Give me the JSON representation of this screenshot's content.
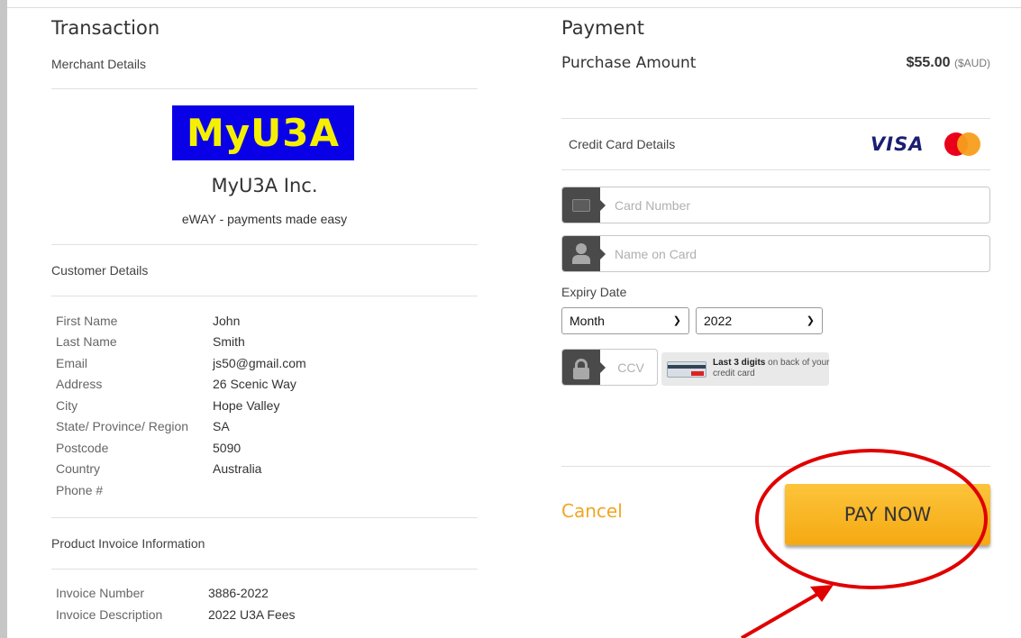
{
  "transaction": {
    "heading": "Transaction",
    "merchant_details_label": "Merchant Details",
    "logo_text": "MyU3A",
    "merchant_name": "MyU3A Inc.",
    "tagline": "eWAY - payments made easy",
    "customer_details_label": "Customer Details",
    "customer": {
      "first_name_key": "First Name",
      "first_name": "John",
      "last_name_key": "Last Name",
      "last_name": "Smith",
      "email_key": "Email",
      "email": "js50@gmail.com",
      "address_key": "Address",
      "address": "26 Scenic Way",
      "city_key": "City",
      "city": "Hope Valley",
      "state_key": "State/ Province/ Region",
      "state": "SA",
      "postcode_key": "Postcode",
      "postcode": "5090",
      "country_key": "Country",
      "country": "Australia",
      "phone_key": "Phone #",
      "phone": ""
    },
    "product_label": "Product Invoice Information",
    "invoice": {
      "number_key": "Invoice Number",
      "number": "3886-2022",
      "description_key": "Invoice Description",
      "description": "2022 U3A Fees"
    }
  },
  "payment": {
    "heading": "Payment",
    "purchase_amount_label": "Purchase Amount",
    "amount": "$55.00",
    "currency": "($AUD)",
    "credit_card_label": "Credit Card Details",
    "visa_logo": "VISA",
    "fields": {
      "card_number_placeholder": "Card Number",
      "name_placeholder": "Name on Card",
      "ccv_placeholder": "CCV"
    },
    "expiry_label": "Expiry Date",
    "expiry_month": "Month",
    "expiry_year": "2022",
    "ccv_hint_bold": "Last 3 digits",
    "ccv_hint_rest": " on back of your credit card",
    "cancel_label": "Cancel",
    "pay_label": "PAY NOW"
  },
  "colors": {
    "accent": "#f0a623",
    "pay_button": "#f5a912",
    "logo_bg": "#0a00e8",
    "logo_text": "#f5f000",
    "annotation": "#e00000"
  },
  "icons": [
    "credit-card-icon",
    "user-icon",
    "lock-icon",
    "chevron-down-icon",
    "visa-logo",
    "mastercard-logo"
  ]
}
